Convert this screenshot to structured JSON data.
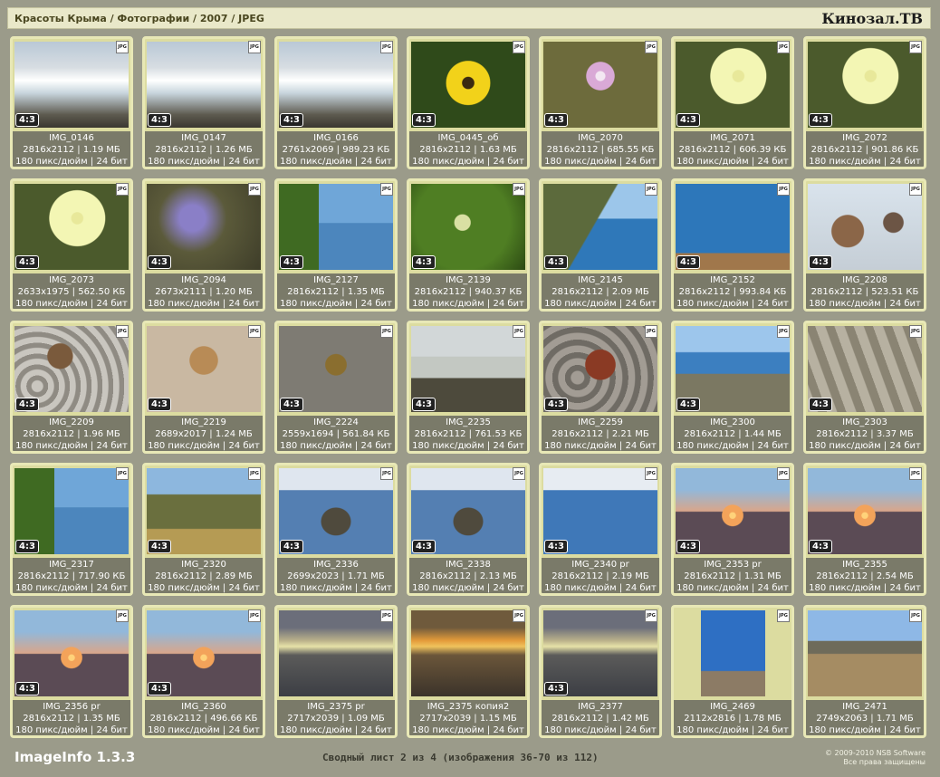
{
  "header": {
    "breadcrumb": "Красоты Крыма / Фотографии / 2007 / JPEG",
    "brand": "Кинозал.ТВ"
  },
  "footer": {
    "app_name": "ImageInfo 1.3.3",
    "summary": "Сводный лист 2 из 4 (изображения 36-70 из 112)",
    "copyright_line1": "© 2009-2010 NSB Software",
    "copyright_line2": "Все права защищены"
  },
  "file_type_icon": "jpg-file-icon",
  "items": [
    {
      "name": "IMG_0146",
      "dims": "2816x2112",
      "size": "1.19 МБ",
      "res": "180 пикс/дюйм | 24 бит",
      "ratio": "4:3",
      "theme": "waves"
    },
    {
      "name": "IMG_0147",
      "dims": "2816x2112",
      "size": "1.26 МБ",
      "res": "180 пикс/дюйм | 24 бит",
      "ratio": "4:3",
      "theme": "waves"
    },
    {
      "name": "IMG_0166",
      "dims": "2761x2069",
      "size": "989.23 КБ",
      "res": "180 пикс/дюйм | 24 бит",
      "ratio": "4:3",
      "theme": "waves"
    },
    {
      "name": "IMG_0445_об",
      "dims": "2816x2112",
      "size": "1.63 МБ",
      "res": "180 пикс/дюйм | 24 бит",
      "ratio": "4:3",
      "theme": "yellowflower"
    },
    {
      "name": "IMG_2070",
      "dims": "2816x2112",
      "size": "685.55 КБ",
      "res": "180 пикс/дюйм | 24 бит",
      "ratio": "4:3",
      "theme": "pinkflower"
    },
    {
      "name": "IMG_2071",
      "dims": "2816x2112",
      "size": "606.39 КБ",
      "res": "180 пикс/дюйм | 24 бит",
      "ratio": "4:3",
      "theme": "paleflower"
    },
    {
      "name": "IMG_2072",
      "dims": "2816x2112",
      "size": "901.86 КБ",
      "res": "180 пикс/дюйм | 24 бит",
      "ratio": "4:3",
      "theme": "paleflower"
    },
    {
      "name": "IMG_2073",
      "dims": "2633x1975",
      "size": "562.50 КБ",
      "res": "180 пикс/дюйм | 24 бит",
      "ratio": "4:3",
      "theme": "paleflower"
    },
    {
      "name": "IMG_2094",
      "dims": "2673x2111",
      "size": "1.20 МБ",
      "res": "180 пикс/дюйм | 24 бит",
      "ratio": "4:3",
      "theme": "lavender"
    },
    {
      "name": "IMG_2127",
      "dims": "2816x2112",
      "size": "1.35 МБ",
      "res": "180 пикс/дюйм | 24 бит",
      "ratio": "4:3",
      "theme": "tree_sea"
    },
    {
      "name": "IMG_2139",
      "dims": "2816x2112",
      "size": "940.37 КБ",
      "res": "180 пикс/дюйм | 24 бит",
      "ratio": "4:3",
      "theme": "greenery"
    },
    {
      "name": "IMG_2145",
      "dims": "2816x2112",
      "size": "2.09 МБ",
      "res": "180 пикс/дюйм | 24 бит",
      "ratio": "4:3",
      "theme": "cliff_sea"
    },
    {
      "name": "IMG_2152",
      "dims": "2816x2112",
      "size": "993.84 КБ",
      "res": "180 пикс/дюйм | 24 бит",
      "ratio": "4:3",
      "theme": "sea_boat"
    },
    {
      "name": "IMG_2208",
      "dims": "2816x2112",
      "size": "523.51 КБ",
      "res": "180 пикс/дюйм | 24 бит",
      "ratio": "4:3",
      "theme": "shells"
    },
    {
      "name": "IMG_2209",
      "dims": "2816x2112",
      "size": "1.96 МБ",
      "res": "180 пикс/дюйм | 24 бит",
      "ratio": "4:3",
      "theme": "pebbles"
    },
    {
      "name": "IMG_2219",
      "dims": "2689x2017",
      "size": "1.24 МБ",
      "res": "180 пикс/дюйм | 24 бит",
      "ratio": "4:3",
      "theme": "crab_sand"
    },
    {
      "name": "IMG_2224",
      "dims": "2559x1694",
      "size": "561.84 КБ",
      "res": "180 пикс/дюйм | 24 бит",
      "ratio": "4:3",
      "theme": "crab_wet"
    },
    {
      "name": "IMG_2235",
      "dims": "2816x2112",
      "size": "761.53 КБ",
      "res": "180 пикс/дюйм | 24 бит",
      "ratio": "4:3",
      "theme": "rocks_calm"
    },
    {
      "name": "IMG_2259",
      "dims": "2816x2112",
      "size": "2.21 МБ",
      "res": "180 пикс/дюйм | 24 бит",
      "ratio": "4:3",
      "theme": "crab_stones"
    },
    {
      "name": "IMG_2300",
      "dims": "2816x2112",
      "size": "1.44 МБ",
      "res": "180 пикс/дюйм | 24 бит",
      "ratio": "4:3",
      "theme": "bay_cliffs"
    },
    {
      "name": "IMG_2303",
      "dims": "2816x2112",
      "size": "3.37 МБ",
      "res": "180 пикс/дюйм | 24 бит",
      "ratio": "4:3",
      "theme": "rock_formations"
    },
    {
      "name": "IMG_2317",
      "dims": "2816x2112",
      "size": "717.90 КБ",
      "res": "180 пикс/дюйм | 24 бит",
      "ratio": "4:3",
      "theme": "tree_sea"
    },
    {
      "name": "IMG_2320",
      "dims": "2816x2112",
      "size": "2.89 МБ",
      "res": "180 пикс/дюйм | 24 бит",
      "ratio": "4:3",
      "theme": "hill_tree"
    },
    {
      "name": "IMG_2336",
      "dims": "2699x2023",
      "size": "1.71 МБ",
      "res": "180 пикс/дюйм | 24 бит",
      "ratio": "4:3",
      "theme": "sea_rock"
    },
    {
      "name": "IMG_2338",
      "dims": "2816x2112",
      "size": "2.13 МБ",
      "res": "180 пикс/дюйм | 24 бит",
      "ratio": "4:3",
      "theme": "sea_rock"
    },
    {
      "name": "IMG_2340 pr",
      "dims": "2816x2112",
      "size": "2.19 МБ",
      "res": "180 пикс/дюйм | 24 бит",
      "ratio": "4:3",
      "theme": "sea_birds"
    },
    {
      "name": "IMG_2353 pr",
      "dims": "2816x2112",
      "size": "1.31 МБ",
      "res": "180 пикс/дюйм | 24 бит",
      "ratio": "4:3",
      "theme": "sunset"
    },
    {
      "name": "IMG_2355",
      "dims": "2816x2112",
      "size": "2.54 МБ",
      "res": "180 пикс/дюйм | 24 бит",
      "ratio": "4:3",
      "theme": "sunset"
    },
    {
      "name": "IMG_2356 pr",
      "dims": "2816x2112",
      "size": "1.35 МБ",
      "res": "180 пикс/дюйм | 24 бит",
      "ratio": "4:3",
      "theme": "sunset"
    },
    {
      "name": "IMG_2360",
      "dims": "2816x2112",
      "size": "496.66 КБ",
      "res": "180 пикс/дюйм | 24 бит",
      "ratio": "4:3",
      "theme": "sunset"
    },
    {
      "name": "IMG_2375 pr",
      "dims": "2717x2039",
      "size": "1.09 МБ",
      "res": "180 пикс/дюйм | 24 бит",
      "ratio": "",
      "theme": "dusk"
    },
    {
      "name": "IMG_2375 копия2",
      "dims": "2717x2039",
      "size": "1.15 МБ",
      "res": "180 пикс/дюйм | 24 бит",
      "ratio": "",
      "theme": "dusk_orange"
    },
    {
      "name": "IMG_2377",
      "dims": "2816x2112",
      "size": "1.42 МБ",
      "res": "180 пикс/дюйм | 24 бит",
      "ratio": "4:3",
      "theme": "dusk"
    },
    {
      "name": "IMG_2469",
      "dims": "2112x2816",
      "size": "1.78 МБ",
      "res": "180 пикс/дюйм | 24 бит",
      "ratio": "",
      "theme": "cross",
      "portrait": true
    },
    {
      "name": "IMG_2471",
      "dims": "2749x2063",
      "size": "1.71 МБ",
      "res": "180 пикс/дюйм | 24 бит",
      "ratio": "",
      "theme": "steppe"
    }
  ]
}
